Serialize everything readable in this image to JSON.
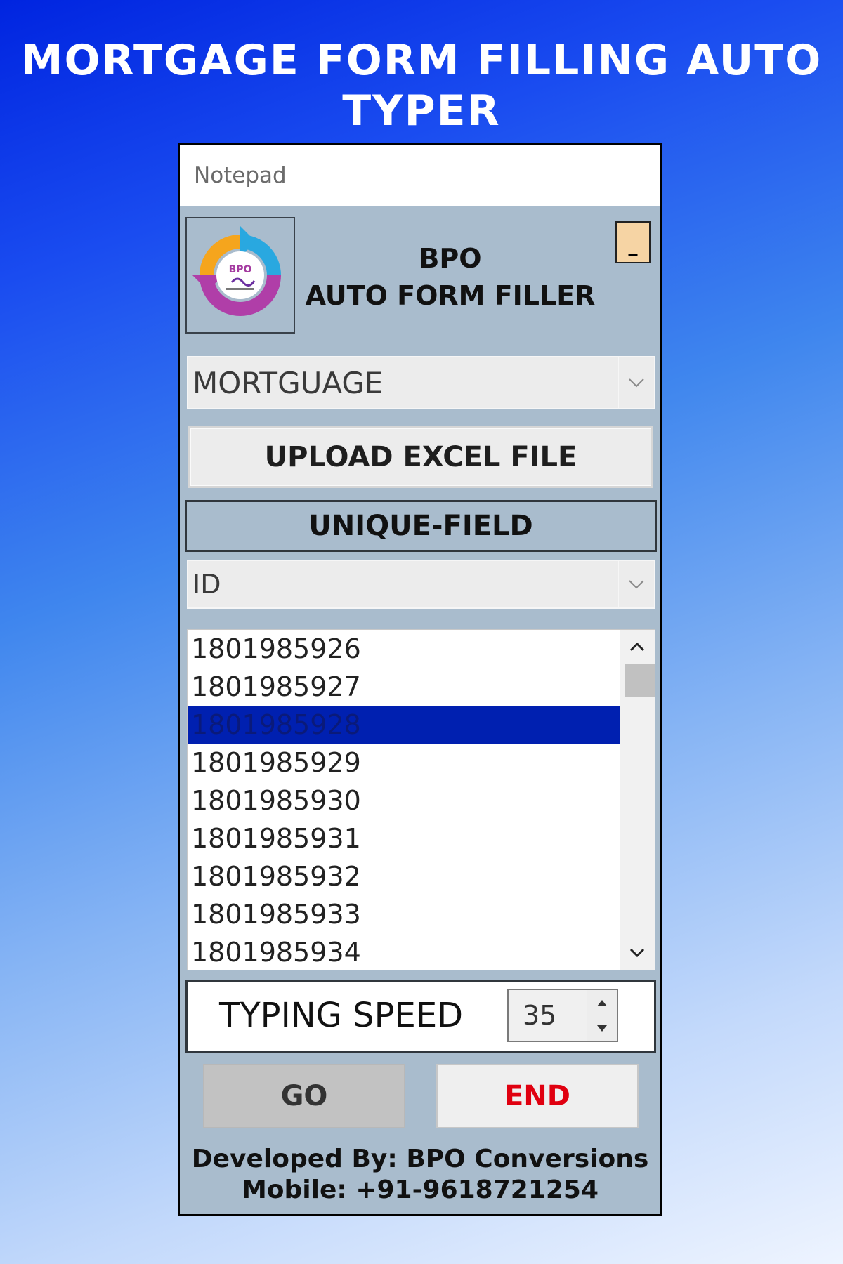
{
  "banner": {
    "title": "MORTGAGE FORM FILLING AUTO TYPER"
  },
  "window": {
    "title": "Notepad",
    "logo_text": "BPO",
    "app_title_line1": "BPO",
    "app_title_line2": "AUTO FORM FILLER",
    "minimize_label": "_"
  },
  "form_type": {
    "selected": "MORTGUAGE"
  },
  "upload_button": {
    "label": "UPLOAD EXCEL FILE"
  },
  "unique_field": {
    "label": "UNIQUE-FIELD",
    "selected": "ID"
  },
  "id_list": {
    "items": [
      "1801985926",
      "1801985927",
      "1801985928",
      "1801985929",
      "1801985930",
      "1801985931",
      "1801985932",
      "1801985933",
      "1801985934"
    ],
    "selected_index": 2
  },
  "typing_speed": {
    "label": "TYPING SPEED",
    "value": "35"
  },
  "actions": {
    "go_label": "GO",
    "end_label": "END"
  },
  "credits": {
    "developer": "Developed By: BPO Conversions",
    "mobile": "Mobile: +91-9618721254"
  },
  "colors": {
    "background_gradient_start": "#0024e0",
    "panel_background": "#a9bccd",
    "selected_row": "#0020b0",
    "end_button_text": "#e00010",
    "minimize_button": "#f6d4a4"
  },
  "icons": {
    "logo": "bpo-circular-arrows-logo",
    "combo_arrow": "chevron-down-icon",
    "scroll_up": "chevron-up-icon",
    "scroll_down": "chevron-down-icon",
    "spin_up": "triangle-up-icon",
    "spin_down": "triangle-down-icon"
  }
}
